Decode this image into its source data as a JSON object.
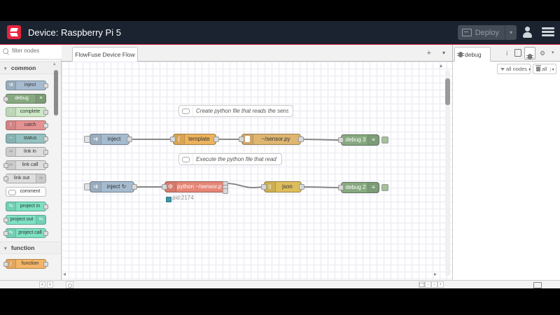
{
  "header": {
    "title": "Device: Raspberry Pi 5",
    "deploy_label": "Deploy"
  },
  "palette": {
    "search_placeholder": "filter nodes",
    "categories": [
      {
        "label": "common",
        "items": [
          {
            "label": "inject",
            "color": "#a6bbcf"
          },
          {
            "label": "debug",
            "color": "#87a980"
          },
          {
            "label": "complete",
            "color": "#cde8c6"
          },
          {
            "label": "catch",
            "color": "#e49191"
          },
          {
            "label": "status",
            "color": "#94c1c1"
          },
          {
            "label": "link in",
            "color": "#dddddd"
          },
          {
            "label": "link call",
            "color": "#dddddd"
          },
          {
            "label": "link out",
            "color": "#dddddd"
          },
          {
            "label": "comment",
            "color": "#ffffff"
          },
          {
            "label": "project in",
            "color": "#7de1c3"
          },
          {
            "label": "project out",
            "color": "#7de1c3"
          },
          {
            "label": "project call",
            "color": "#7de1c3"
          }
        ]
      },
      {
        "label": "function",
        "items": [
          {
            "label": "function",
            "color": "#f3b567"
          }
        ]
      }
    ]
  },
  "workspace": {
    "tab_label": "FlowFuse Device Flow",
    "comments": [
      {
        "text": "Create python file that reads the sensor data"
      },
      {
        "text": "Execute the python file that read the data"
      }
    ],
    "nodes": {
      "inject1": {
        "label": "inject",
        "color": "#a6bbcf"
      },
      "template": {
        "label": "template",
        "color": "#ecb25c"
      },
      "sensor_file": {
        "label": "~/sensor.py",
        "color": "#dfb671"
      },
      "debug3": {
        "label": "debug 3",
        "color": "#87a980"
      },
      "inject2": {
        "label": "inject ↻",
        "color": "#a6bbcf"
      },
      "exec": {
        "label": "python ~/sensor.py",
        "color": "#e68576",
        "status": "pid:2174"
      },
      "json": {
        "label": "json",
        "color": "#debd5c"
      },
      "debug2": {
        "label": "debug 2",
        "color": "#87a980"
      }
    }
  },
  "sidebar": {
    "tab_label": "debug",
    "filter_button": "all nodes",
    "clear_button": "all"
  },
  "node_glyphs": {
    "inject": "⇉",
    "debug": "≡",
    "complete": "!",
    "catch": "!",
    "status": "~",
    "link": "∞",
    "project": "⇆",
    "function": "f",
    "template": "{",
    "exec": "⚙",
    "json": "{}"
  },
  "icons": {
    "plus": "+",
    "caret_down": "▾",
    "category_chevron": "▾",
    "scroll_up": "▴",
    "scroll_left": "◂",
    "scroll_right": "▸",
    "collapse_all": "∧",
    "expand_all": "∨",
    "zoom_out": "−",
    "zoom_reset": "○",
    "zoom_in": "+",
    "info": "i",
    "gear": "⚙"
  },
  "colors": {
    "accent_red": "#d5273f",
    "header_bg": "#1b2330",
    "wire": "#888888",
    "grid": "#e9e9f2",
    "status_blue": "#3d95a5"
  }
}
